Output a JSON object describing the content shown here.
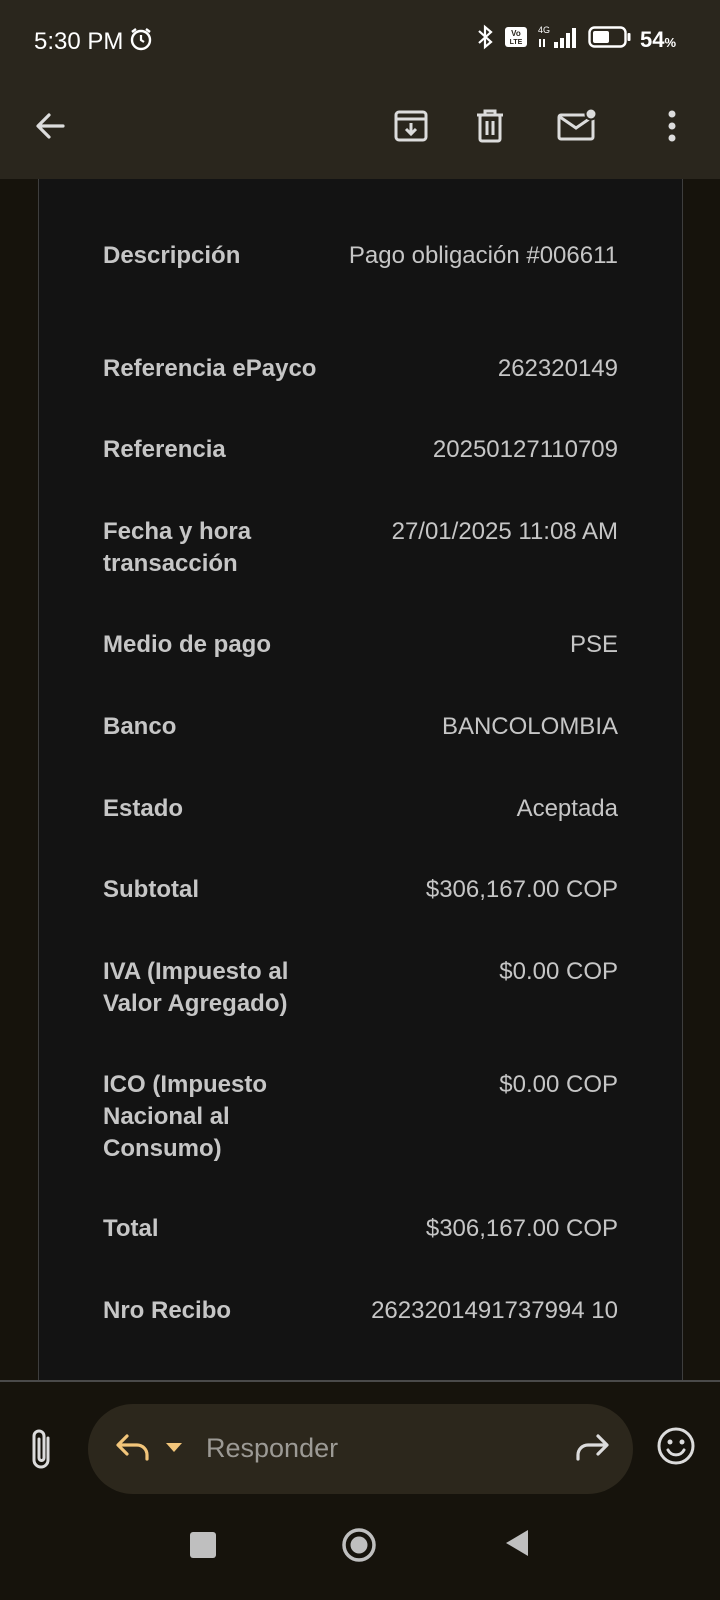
{
  "status_bar": {
    "time": "5:30 PM",
    "battery_pct": "54",
    "battery_unit": "%",
    "battery_level": 0.54,
    "network": "4G",
    "volte": "Vo LTE",
    "icons": [
      "alarm-icon",
      "bluetooth-icon",
      "volte-icon",
      "signal-icon",
      "battery-icon"
    ]
  },
  "app_bar": {
    "icons": [
      "back-arrow-icon",
      "archive-icon",
      "delete-icon",
      "mark-unread-icon",
      "more-icon"
    ]
  },
  "receipt": {
    "rows": [
      {
        "label": "Descripción",
        "value": "Pago obligación #006611"
      },
      {
        "label": "Referencia ePayco",
        "value": "262320149"
      },
      {
        "label": "Referencia",
        "value": "20250127110709"
      },
      {
        "label": "Fecha y hora transacción",
        "value": "27/01/2025 11:08 AM"
      },
      {
        "label": "Medio de pago",
        "value": "PSE"
      },
      {
        "label": "Banco",
        "value": "BANCOLOMBIA"
      },
      {
        "label": "Estado",
        "value": "Aceptada"
      },
      {
        "label": "Subtotal",
        "value": "$306,167.00 COP"
      },
      {
        "label": "IVA (Impuesto al Valor Agregado)",
        "value": "$0.00 COP"
      },
      {
        "label": "ICO (Impuesto Nacional al Consumo)",
        "value": "$0.00 COP"
      },
      {
        "label": "Total",
        "value": "$306,167.00 COP"
      },
      {
        "label": "Nro Recibo",
        "value": "2623201491737994 10"
      }
    ]
  },
  "reply_bar": {
    "placeholder": "Responder",
    "icons": [
      "attachment-icon",
      "reply-icon",
      "dropdown-caret-icon",
      "forward-icon",
      "emoji-icon"
    ]
  },
  "colors": {
    "background": "#16130c",
    "app_bar": "#2a261d",
    "card": "#131313",
    "accent": "#f2c57a",
    "text": "#c6c6c6"
  }
}
